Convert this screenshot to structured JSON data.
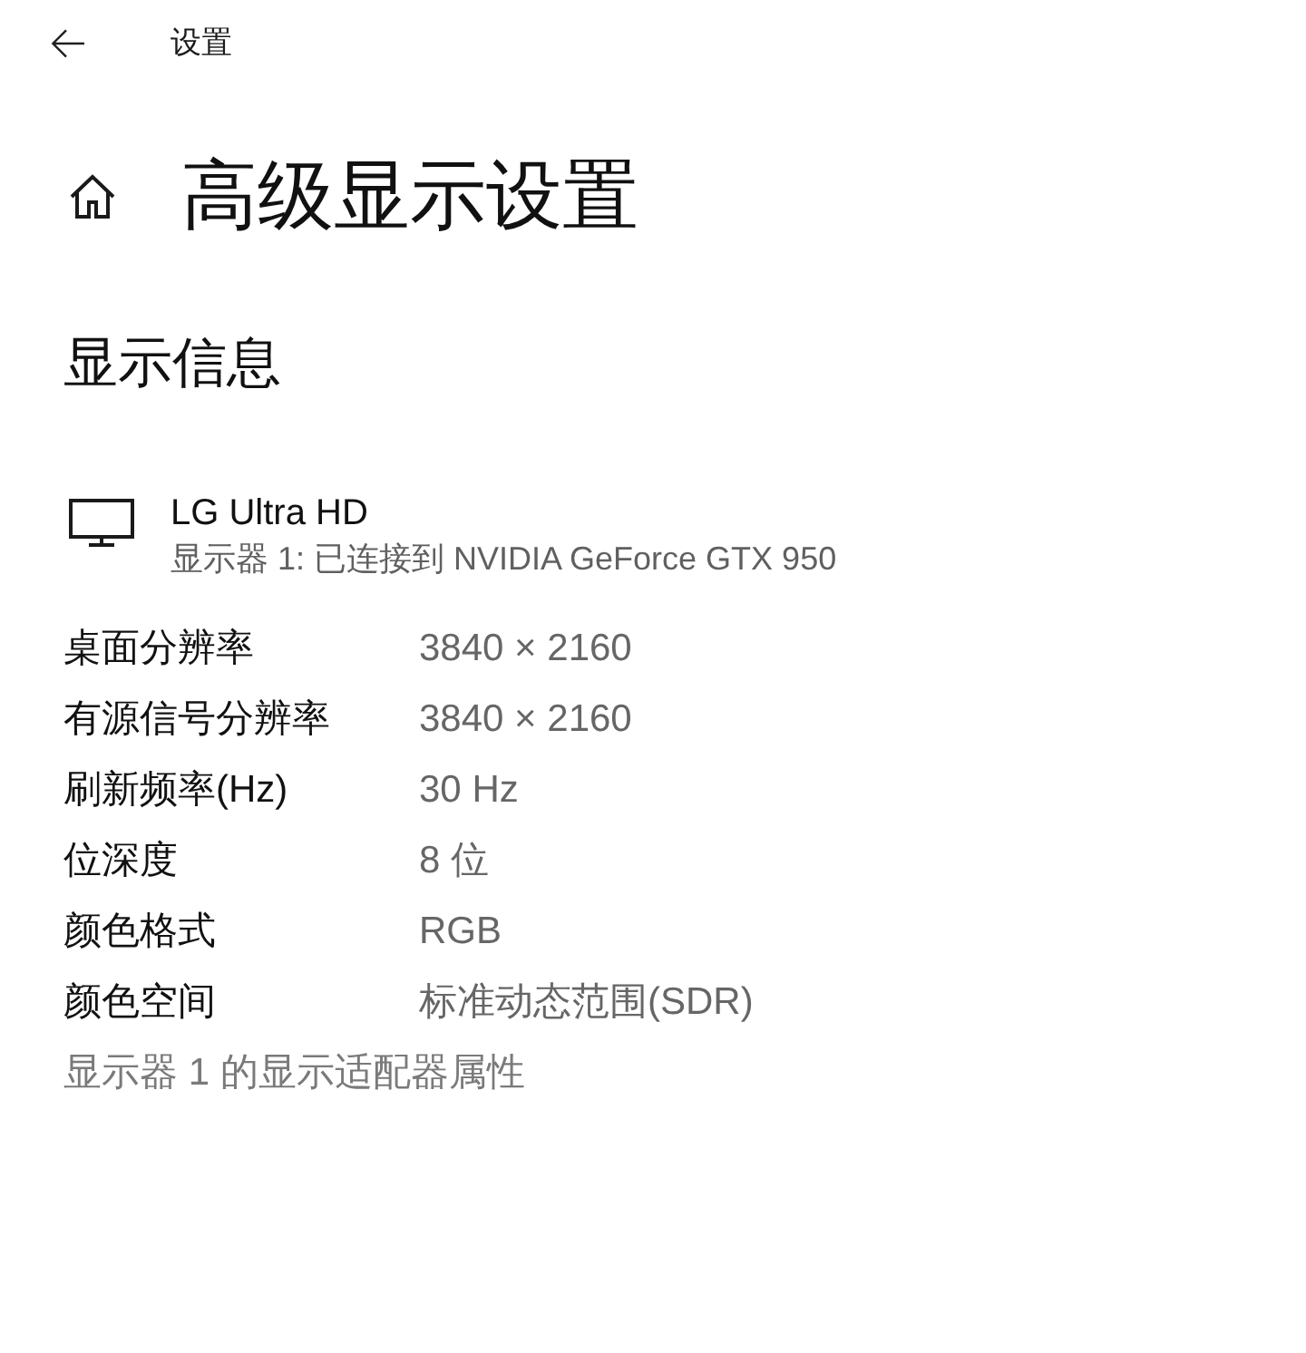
{
  "header": {
    "title": "设置"
  },
  "page": {
    "title": "高级显示设置"
  },
  "section": {
    "title": "显示信息"
  },
  "display": {
    "name": "LG Ultra HD",
    "description": "显示器 1: 已连接到 NVIDIA GeForce GTX 950"
  },
  "properties": [
    {
      "label": "桌面分辨率",
      "value": "3840 × 2160"
    },
    {
      "label": "有源信号分辨率",
      "value": "3840 × 2160"
    },
    {
      "label": "刷新频率(Hz)",
      "value": "30 Hz"
    },
    {
      "label": "位深度",
      "value": "8 位"
    },
    {
      "label": "颜色格式",
      "value": "RGB"
    },
    {
      "label": "颜色空间",
      "value": "标准动态范围(SDR)"
    }
  ],
  "link": {
    "label": "显示器 1 的显示适配器属性",
    "disabled": true
  }
}
